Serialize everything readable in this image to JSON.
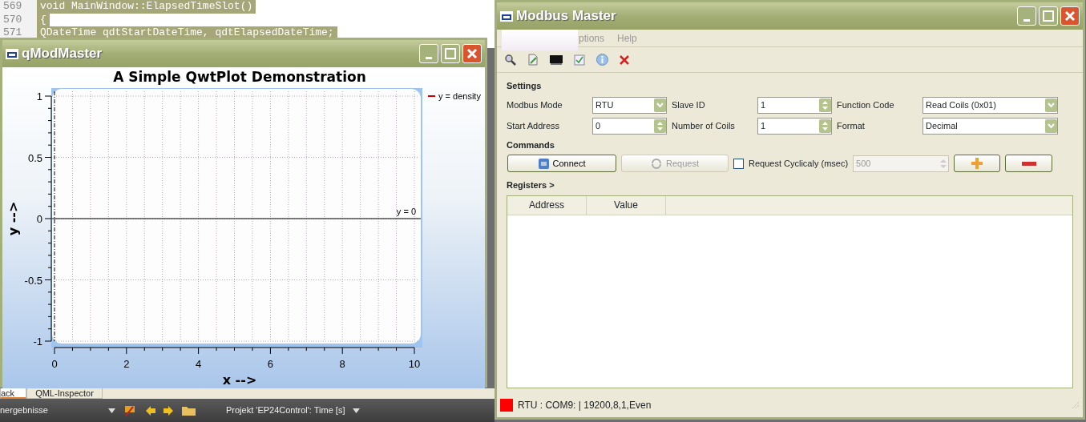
{
  "editor": {
    "lines": [
      {
        "number": "569",
        "code": "void MainWindow::ElapsedTimeSlot()"
      },
      {
        "number": "570",
        "code": "{"
      },
      {
        "number": "571",
        "code": "QDateTime qdtStartDateTime, qdtElapsedDateTime;"
      }
    ]
  },
  "plot_window": {
    "title": "qModMaster",
    "legend": [
      {
        "label": "y = density",
        "color": "#cc0000"
      }
    ],
    "chart_data": {
      "type": "line",
      "title": "A Simple QwtPlot Demonstration",
      "xlabel": "x -->",
      "ylabel": "y -->",
      "xlim": [
        0,
        10
      ],
      "ylim": [
        -1,
        1
      ],
      "xticks": [
        0,
        2,
        4,
        6,
        8,
        10
      ],
      "yticks": [
        -1,
        -0.5,
        0,
        0.5,
        1
      ],
      "grid": true,
      "ref_lines": [
        {
          "axis": "y",
          "value": 0,
          "label": "y = 0"
        }
      ]
    }
  },
  "bottom_panel": {
    "tabs": [
      {
        "label": "ack",
        "selected": true
      },
      {
        "label": "QML-Inspector",
        "selected": false
      }
    ],
    "output_dropdown": "nergebnisse",
    "project_label": "Projekt 'EP24Control': Time [s]"
  },
  "modbus_window": {
    "title": "Modbus Master",
    "menu": [
      "ptions",
      "Help"
    ],
    "settings": {
      "heading": "Settings",
      "fields": [
        {
          "label": "Modbus Mode",
          "kind": "combo",
          "value": "RTU"
        },
        {
          "label": "Slave ID",
          "kind": "spin",
          "value": "1"
        },
        {
          "label": "Function Code",
          "kind": "combo",
          "value": "Read Coils (0x01)"
        },
        {
          "label": "Start Address",
          "kind": "spin",
          "value": "0"
        },
        {
          "label": "Number of Coils",
          "kind": "spin",
          "value": "1"
        },
        {
          "label": "Format",
          "kind": "combo",
          "value": "Decimal"
        }
      ]
    },
    "commands": {
      "heading": "Commands",
      "connect": {
        "label": "Connect"
      },
      "request": {
        "label": "Request",
        "disabled": true
      },
      "cyclic": {
        "label": "Request Cyclicaly (msec)",
        "checked": false
      },
      "interval": {
        "value": "500",
        "disabled": true
      }
    },
    "registers": {
      "heading": "Registers >",
      "columns": [
        "Address",
        "Value"
      ]
    },
    "status_bar": {
      "text": "RTU : COM9: | 19200,8,1,Even",
      "color": "#ff0000"
    }
  }
}
